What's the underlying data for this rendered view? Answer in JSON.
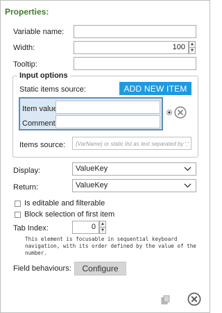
{
  "title": "Properties:",
  "variable_name": {
    "label": "Variable name:",
    "value": ""
  },
  "width": {
    "label": "Width:",
    "value": "100"
  },
  "tooltip": {
    "label": "Tooltip:",
    "value": ""
  },
  "input_options": {
    "title": "Input options",
    "static_source_label": "Static items source:",
    "add_button": "ADD NEW ITEM",
    "item_value_label": "Item value:",
    "item_value": "",
    "comment_label": "Comment:",
    "comment": "",
    "items_source_label": "Items source:",
    "items_source_placeholder": "{VarName} or static list as text separated by ';'"
  },
  "display": {
    "label": "Display:",
    "value": "ValueKey"
  },
  "return": {
    "label": "Return:",
    "value": "ValueKey"
  },
  "checkboxes": [
    {
      "label": "Is editable and filterable",
      "checked": false
    },
    {
      "label": "Block selection of first item",
      "checked": false
    }
  ],
  "tab_index": {
    "label": "Tab Index:",
    "value": "0",
    "help": "This element is focusable in sequential keyboard navigation, with its order defined by the value of the number."
  },
  "field_behaviours": {
    "label": "Field behaviours:",
    "button": "Configure"
  },
  "icons": {
    "copy": "copy-icon",
    "close": "close-circle-icon",
    "remove": "remove-circle-icon"
  }
}
